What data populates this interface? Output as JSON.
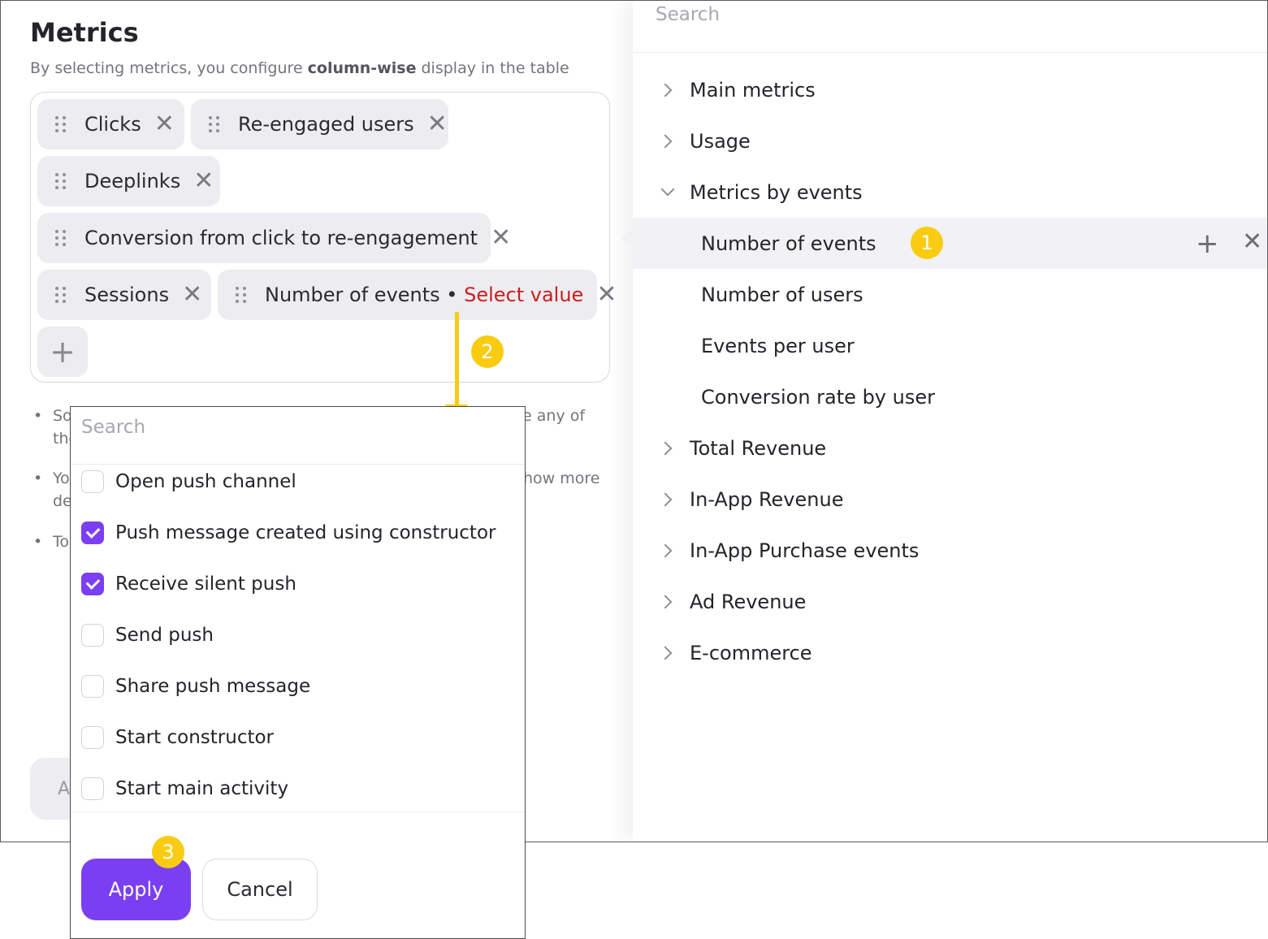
{
  "metrics_panel": {
    "title": "Metrics",
    "subtitle_pre": "By selecting metrics, you configure ",
    "subtitle_bold": "column-wise",
    "subtitle_post": " display in the table",
    "chips": [
      {
        "label": "Clicks"
      },
      {
        "label": "Re-engaged users"
      },
      {
        "label": "Deeplinks"
      },
      {
        "label": "Conversion from click to re-engagement"
      },
      {
        "label": "Sessions"
      },
      {
        "label": "Number of events",
        "separator": " • ",
        "value_prompt": "Select value"
      }
    ],
    "remove_glyph": "✕",
    "add_glyph": "+",
    "notes": [
      {
        "left": "So",
        "left2": "the",
        "right": "e any of"
      },
      {
        "left": "Yo",
        "left2": "de",
        "right": "how more"
      },
      {
        "left": "To"
      }
    ],
    "bullet": "•",
    "bottom_button_fragment": "A"
  },
  "metric_tree": {
    "search_placeholder": "Search",
    "groups": [
      {
        "label": "Main metrics",
        "expanded": false
      },
      {
        "label": "Usage",
        "expanded": false
      },
      {
        "label": "Metrics by events",
        "expanded": true
      },
      {
        "label": "Total Revenue",
        "expanded": false
      },
      {
        "label": "In-App Revenue",
        "expanded": false
      },
      {
        "label": "In-App Purchase events",
        "expanded": false
      },
      {
        "label": "Ad Revenue",
        "expanded": false
      },
      {
        "label": "E-commerce",
        "expanded": false
      }
    ],
    "event_metrics": [
      {
        "label": "Number of events",
        "active": true
      },
      {
        "label": "Number of users"
      },
      {
        "label": "Events per user"
      },
      {
        "label": "Conversion rate by user"
      }
    ],
    "add_glyph": "+",
    "remove_glyph": "✕"
  },
  "event_dropdown": {
    "search_placeholder": "Search",
    "items": [
      {
        "label": "Open push channel",
        "checked": false
      },
      {
        "label": "Push message created using constructor",
        "checked": true
      },
      {
        "label": "Receive silent push",
        "checked": true
      },
      {
        "label": "Send push",
        "checked": false
      },
      {
        "label": "Share push message",
        "checked": false
      },
      {
        "label": "Start constructor",
        "checked": false
      },
      {
        "label": "Start main activity",
        "checked": false
      }
    ],
    "apply_label": "Apply",
    "cancel_label": "Cancel"
  },
  "annotations": {
    "badge_1": "1",
    "badge_2": "2",
    "badge_3": "3",
    "color": "#f9cc12"
  },
  "colors": {
    "accent": "#7b3ff2",
    "error_text": "#c81f1f",
    "chip_bg": "#ececf1"
  }
}
